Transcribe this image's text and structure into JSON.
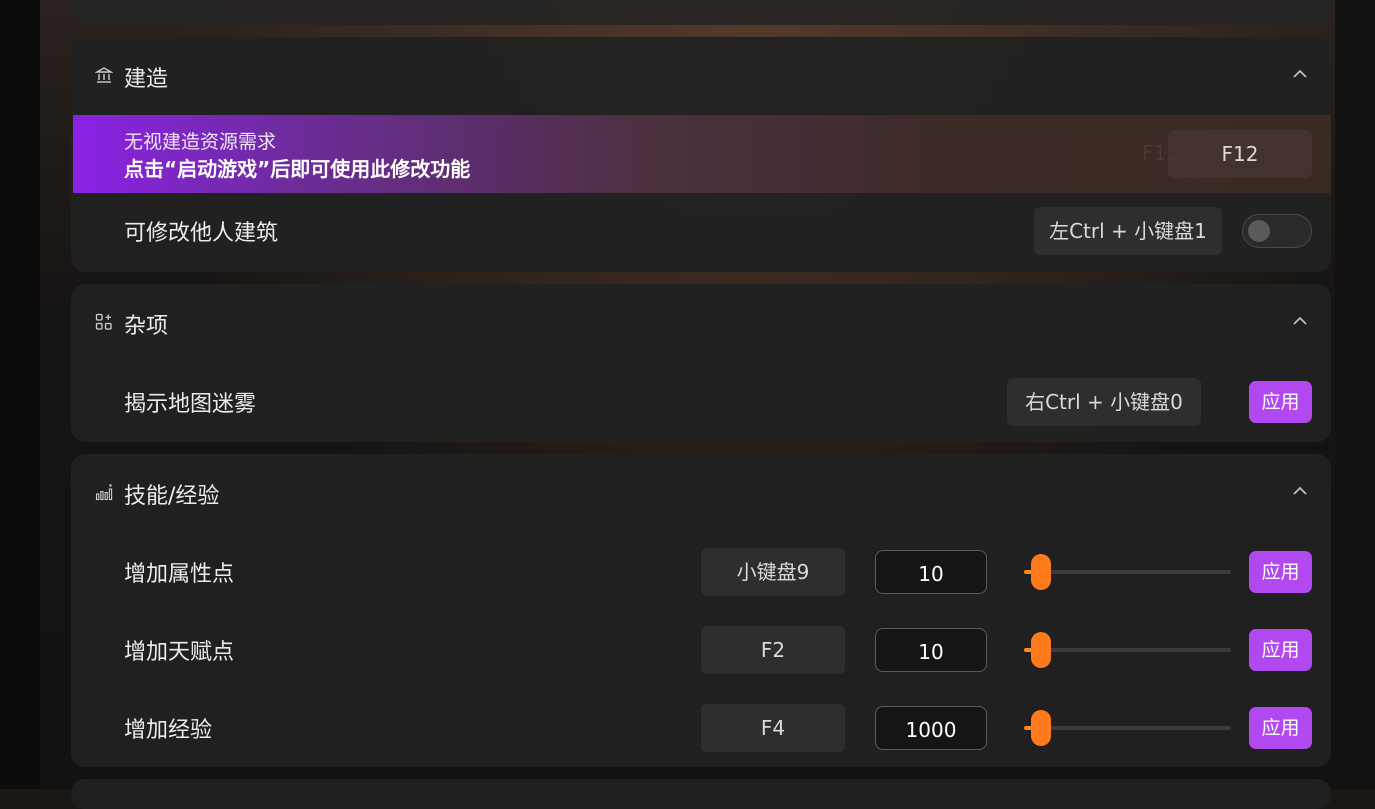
{
  "sections": {
    "build": {
      "title": "建造",
      "icon": "bank-icon",
      "highlight": {
        "label": "无视建造资源需求",
        "notice": "点击“启动游戏”后即可使用此修改功能",
        "ghost_hotkey": "F12",
        "hotkey": "F12"
      },
      "rows": [
        {
          "label": "可修改他人建筑",
          "hotkey": "左Ctrl + 小键盘1",
          "toggle": false
        }
      ]
    },
    "misc": {
      "title": "杂项",
      "icon": "apps-add-icon",
      "rows": [
        {
          "label": "揭示地图迷雾",
          "hotkey": "右Ctrl + 小键盘0",
          "action": "应用"
        }
      ]
    },
    "skills": {
      "title": "技能/经验",
      "icon": "bar-chart-icon",
      "rows": [
        {
          "label": "增加属性点",
          "hotkey": "小键盘9",
          "value": "10",
          "slider_fraction": 0.08,
          "action": "应用"
        },
        {
          "label": "增加天赋点",
          "hotkey": "F2",
          "value": "10",
          "slider_fraction": 0.08,
          "action": "应用"
        },
        {
          "label": "增加经验",
          "hotkey": "F4",
          "value": "1000",
          "slider_fraction": 0.08,
          "action": "应用"
        }
      ]
    }
  },
  "colors": {
    "accent": "#b249f0",
    "slider": "#ff7a1a"
  }
}
